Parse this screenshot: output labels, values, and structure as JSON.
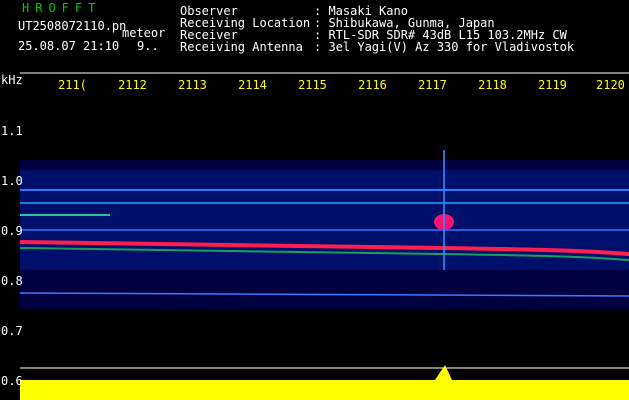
{
  "header": {
    "brand": "HROFFT",
    "filename": "UT2508072110.pn",
    "mode": "meteor",
    "date": "25.08.07 21:10",
    "count": "9..",
    "labels": [
      "Observer",
      "Receiving Location",
      "Receiver",
      "Receiving Antenna"
    ],
    "values": [
      ": Masaki Kano",
      ": Shibukawa, Gunma, Japan",
      ": RTL-SDR SDR# 43dB L15 103.2MHz CW",
      ": 3el Yagi(V) Az 330 for Vladivostok"
    ]
  },
  "axes": {
    "unit": "kHz",
    "x_ticks": [
      "211(",
      "2112",
      "2113",
      "2114",
      "2115",
      "2116",
      "2117",
      "2118",
      "2119",
      "2120"
    ],
    "y_ticks": [
      "1.1",
      "1.0",
      "0.9",
      "0.8",
      "0.7",
      "0.6"
    ]
  },
  "colors": {
    "background": "#000000",
    "header_label": "#ffffff",
    "axis": "#ffff00",
    "brand": "#00c800"
  }
}
